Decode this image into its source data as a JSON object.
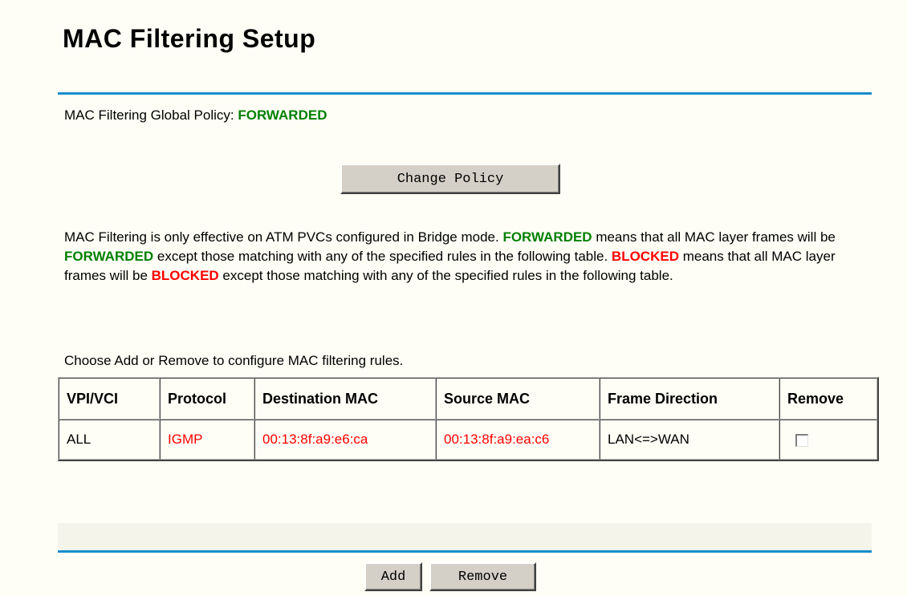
{
  "page": {
    "title": "MAC Filtering Setup"
  },
  "policy": {
    "label": "MAC Filtering Global Policy: ",
    "value": "FORWARDED",
    "change_button": "Change Policy"
  },
  "description": {
    "p1": "MAC Filtering is only effective on ATM PVCs configured in Bridge mode. ",
    "fw1": "FORWARDED",
    "p2": " means that all MAC layer frames will be ",
    "fw2": "FORWARDED",
    "p3": " except those matching with any of the specified rules in the following table. ",
    "bl1": "BLOCKED",
    "p4": " means that all MAC layer frames will be ",
    "bl2": "BLOCKED",
    "p5": " except those matching with any of the specified rules in the following table."
  },
  "instructions": "Choose Add or Remove to configure MAC filtering rules.",
  "table": {
    "headers": [
      "VPI/VCI",
      "Protocol",
      "Destination MAC",
      "Source MAC",
      "Frame Direction",
      "Remove"
    ],
    "rows": [
      {
        "vpi_vci": "ALL",
        "protocol": "IGMP",
        "destination_mac": "00:13:8f:a9:e6:ca",
        "source_mac": "00:13:8f:a9:ea:c6",
        "frame_direction": "LAN<=>WAN",
        "remove_checked": false
      }
    ]
  },
  "buttons": {
    "add": "Add",
    "remove": "Remove"
  },
  "colors": {
    "accent_rule": "#1a8ccc",
    "forwarded": "#008000",
    "blocked": "#ff0000"
  }
}
